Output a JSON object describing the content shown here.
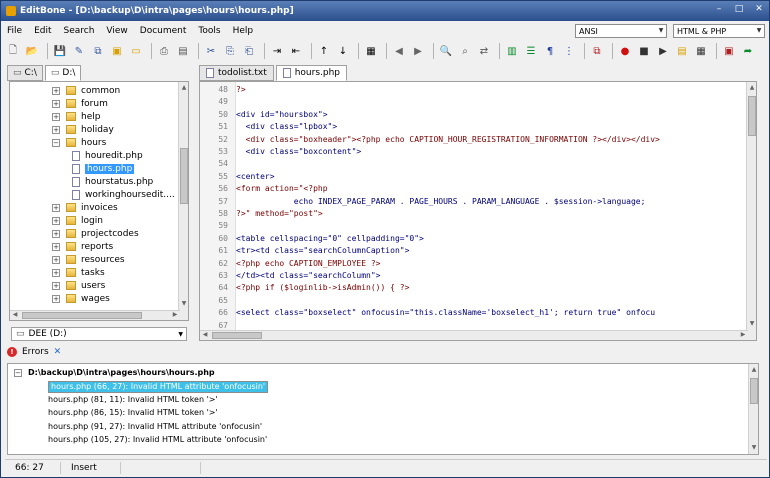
{
  "window": {
    "app": "EditBone",
    "title": "EditBone - [D:\\backup\\D\\intra\\pages\\hours\\hours.php]"
  },
  "menu": [
    "File",
    "Edit",
    "Search",
    "View",
    "Document",
    "Tools",
    "Help"
  ],
  "encoding": "ANSI",
  "highlighter": "HTML & PHP",
  "left_tabs": [
    "C:\\",
    "D:\\"
  ],
  "tree": [
    {
      "label": "common",
      "type": "folder",
      "indent": 1,
      "expander": "+"
    },
    {
      "label": "forum",
      "type": "folder",
      "indent": 1,
      "expander": "+"
    },
    {
      "label": "help",
      "type": "folder",
      "indent": 1,
      "expander": "+"
    },
    {
      "label": "holiday",
      "type": "folder",
      "indent": 1,
      "expander": "+"
    },
    {
      "label": "hours",
      "type": "folder",
      "indent": 1,
      "expander": "−"
    },
    {
      "label": "houredit.php",
      "type": "file",
      "indent": 2
    },
    {
      "label": "hours.php",
      "type": "file",
      "indent": 2,
      "selected": true
    },
    {
      "label": "hourstatus.php",
      "type": "file",
      "indent": 2
    },
    {
      "label": "workinghoursedit....",
      "type": "file",
      "indent": 2
    },
    {
      "label": "invoices",
      "type": "folder",
      "indent": 1,
      "expander": "+"
    },
    {
      "label": "login",
      "type": "folder",
      "indent": 1,
      "expander": "+"
    },
    {
      "label": "projectcodes",
      "type": "folder",
      "indent": 1,
      "expander": "+"
    },
    {
      "label": "reports",
      "type": "folder",
      "indent": 1,
      "expander": "+"
    },
    {
      "label": "resources",
      "type": "folder",
      "indent": 1,
      "expander": "+"
    },
    {
      "label": "tasks",
      "type": "folder",
      "indent": 1,
      "expander": "+"
    },
    {
      "label": "users",
      "type": "folder",
      "indent": 1,
      "expander": "+"
    },
    {
      "label": "wages",
      "type": "folder",
      "indent": 1,
      "expander": "+"
    }
  ],
  "drive": "DEE (D:)",
  "editor_tabs": [
    "todolist.txt",
    "hours.php"
  ],
  "code": [
    {
      "n": "48",
      "t": "?>"
    },
    {
      "n": "49",
      "t": ""
    },
    {
      "n": "50",
      "t": "<div id=\"hoursbox\">"
    },
    {
      "n": "51",
      "t": "  <div class=\"lpbox\">"
    },
    {
      "n": "52",
      "t": "  <div class=\"boxheader\"><?php echo CAPTION_HOUR_REGISTRATION_INFORMATION ?></div></div>"
    },
    {
      "n": "53",
      "t": "  <div class=\"boxcontent\">"
    },
    {
      "n": "54",
      "t": ""
    },
    {
      "n": "55",
      "t": "<center>"
    },
    {
      "n": "56",
      "t": "<form action=\"<?php"
    },
    {
      "n": "57",
      "t": "            echo INDEX_PAGE_PARAM . PAGE_HOURS . PARAM_LANGUAGE . $session->language;"
    },
    {
      "n": "58",
      "t": "?>\" method=\"post\">"
    },
    {
      "n": "59",
      "t": ""
    },
    {
      "n": "60",
      "t": "<table cellspacing=\"0\" cellpadding=\"0\">"
    },
    {
      "n": "61",
      "t": "<tr><td class=\"searchColumnCaption\">"
    },
    {
      "n": "62",
      "t": "<?php echo CAPTION_EMPLOYEE ?>"
    },
    {
      "n": "63",
      "t": "</td><td class=\"searchColumn\">"
    },
    {
      "n": "64",
      "t": "<?php if ($loginlib->isAdmin()) { ?>"
    },
    {
      "n": "65",
      "t": ""
    },
    {
      "n": "66",
      "t": "<select class=\"boxselect\" onfocusin=\"this.className='boxselect_h1'; return true\" onfocu"
    },
    {
      "n": "67",
      "t": ""
    }
  ],
  "errors_tab": "Errors",
  "errors_file": "D:\\backup\\D\\intra\\pages\\hours\\hours.php",
  "errors": [
    "hours.php (66, 27): Invalid HTML attribute 'onfocusin'",
    "hours.php (81, 11): Invalid HTML token '>'",
    "hours.php (86, 15): Invalid HTML token '>'",
    "hours.php (91, 27): Invalid HTML attribute 'onfocusin'",
    "hours.php (105, 27): Invalid HTML attribute 'onfocusin'"
  ],
  "status": {
    "position": "66: 27",
    "mode": "Insert"
  }
}
